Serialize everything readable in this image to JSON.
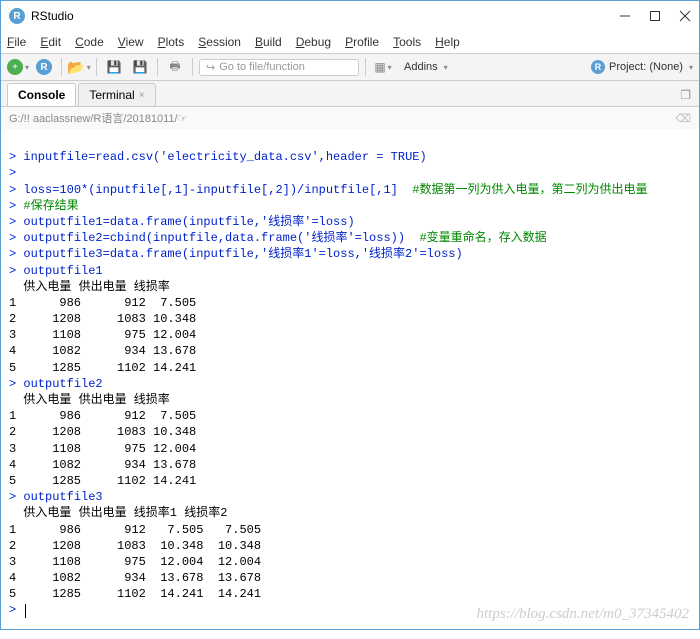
{
  "window": {
    "title": "RStudio"
  },
  "menu": {
    "file": "File",
    "edit": "Edit",
    "code": "Code",
    "view": "View",
    "plots": "Plots",
    "session": "Session",
    "build": "Build",
    "debug": "Debug",
    "profile": "Profile",
    "tools": "Tools",
    "help": "Help"
  },
  "toolbar": {
    "goto_placeholder": "Go to file/function",
    "addins_label": "Addins",
    "project_label": "Project: (None)"
  },
  "tabs": {
    "console": "Console",
    "terminal": "Terminal"
  },
  "pathbar": {
    "path": "G:/!! aaclassnew/R语言/20181011/ "
  },
  "console": {
    "l1_code": "inputfile=read.csv('electricity_data.csv',header = TRUE)",
    "l2_code": "",
    "l3_code": "loss=100*(inputfile[,1]-inputfile[,2])/inputfile[,1]  ",
    "l3_comment": "#数据第一列为供入电量，第二列为供出电量",
    "l4_comment": "#保存结果",
    "l5_code": "outputfile1=data.frame(inputfile,'线损率'=loss)",
    "l6_code": "outputfile2=cbind(inputfile,data.frame('线损率'=loss))  ",
    "l6_comment": "#变量重命名，存入数据",
    "l7_code": "outputfile3=data.frame(inputfile,'线损率1'=loss,'线损率2'=loss)",
    "l8_code": "outputfile1",
    "header1": "  供入电量 供出电量 线损率",
    "t1r1": "1      986      912  7.505",
    "t1r2": "2     1208     1083 10.348",
    "t1r3": "3     1108      975 12.004",
    "t1r4": "4     1082      934 13.678",
    "t1r5": "5     1285     1102 14.241",
    "l9_code": "outputfile2",
    "header2": "  供入电量 供出电量 线损率",
    "t2r1": "1      986      912  7.505",
    "t2r2": "2     1208     1083 10.348",
    "t2r3": "3     1108      975 12.004",
    "t2r4": "4     1082      934 13.678",
    "t2r5": "5     1285     1102 14.241",
    "l10_code": "outputfile3",
    "header3": "  供入电量 供出电量 线损率1 线损率2",
    "t3r1": "1      986      912   7.505   7.505",
    "t3r2": "2     1208     1083  10.348  10.348",
    "t3r3": "3     1108      975  12.004  12.004",
    "t3r4": "4     1082      934  13.678  13.678",
    "t3r5": "5     1285     1102  14.241  14.241",
    "prompt": "> "
  },
  "watermark": "https://blog.csdn.net/m0_37345402"
}
